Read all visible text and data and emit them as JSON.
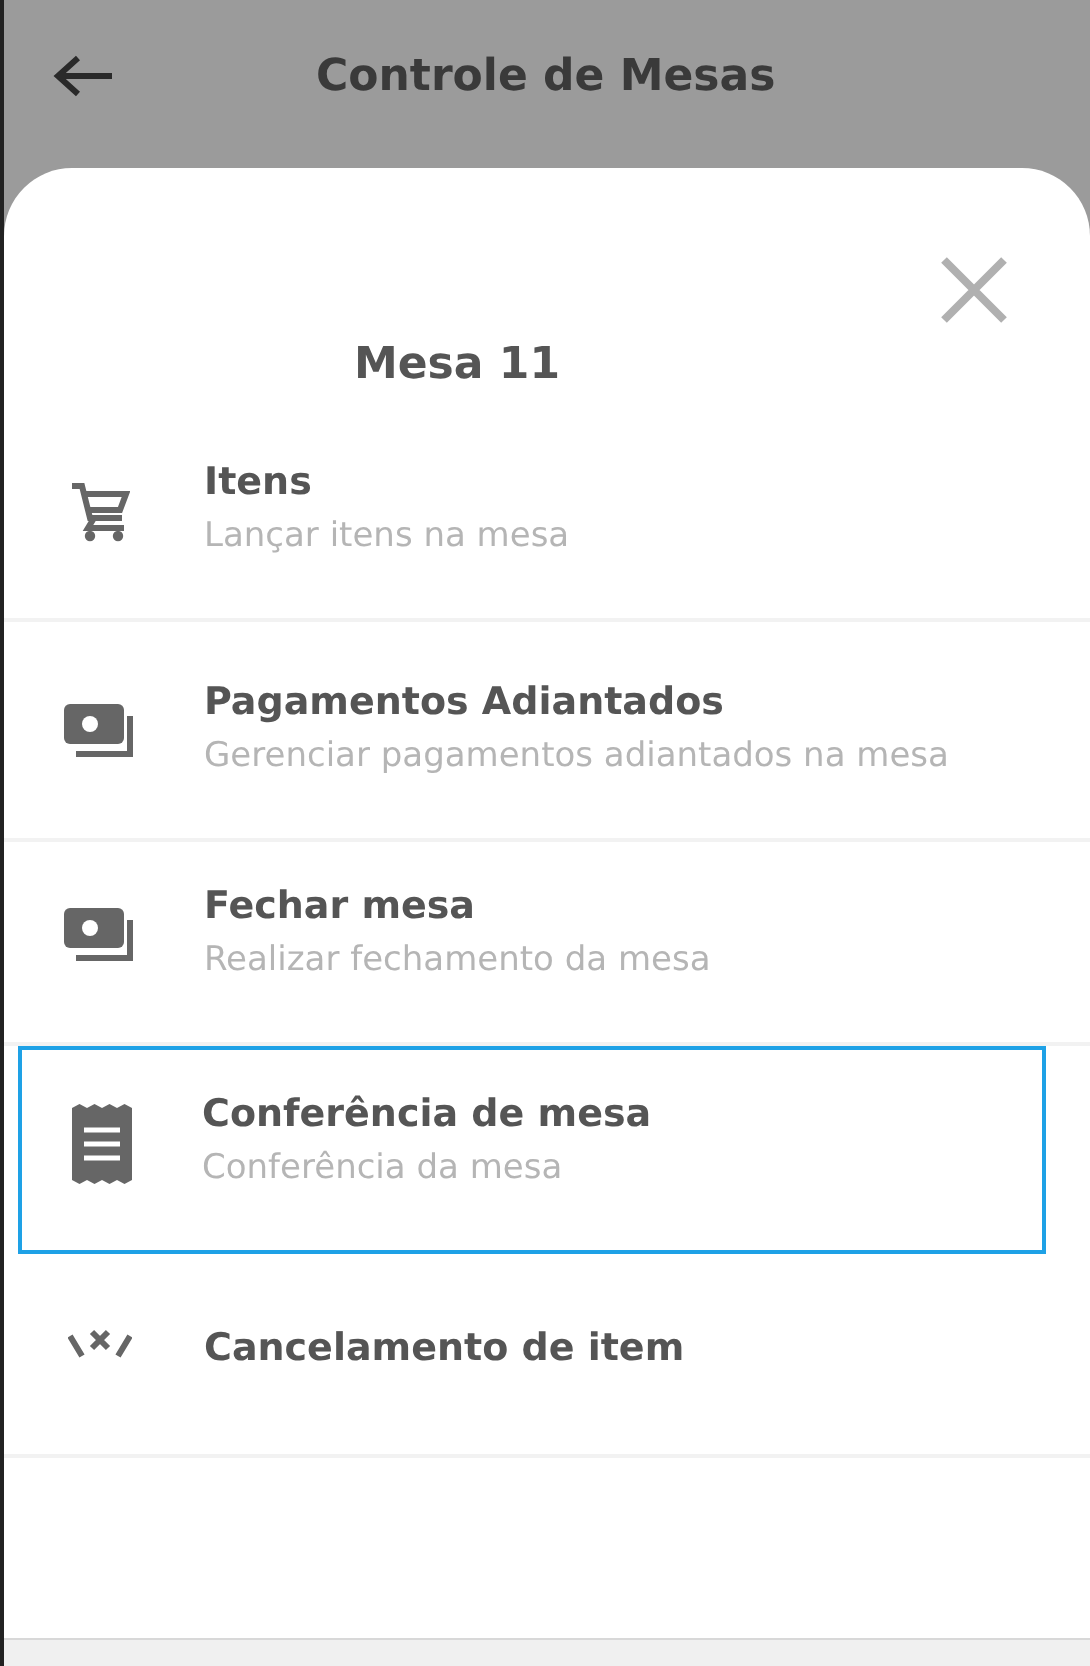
{
  "header": {
    "title": "Controle de Mesas"
  },
  "sheet": {
    "title": "Mesa 11",
    "items": [
      {
        "kind": "cart",
        "title": "Itens",
        "subtitle": "Lançar itens na mesa",
        "selected": false
      },
      {
        "kind": "money",
        "title": "Pagamentos Adiantados",
        "subtitle": "Gerenciar pagamentos adiantados na mesa",
        "selected": false
      },
      {
        "kind": "money",
        "title": "Fechar mesa",
        "subtitle": "Realizar fechamento da mesa",
        "selected": false
      },
      {
        "kind": "receipt",
        "title": "Conferência de mesa",
        "subtitle": "Conferência da mesa",
        "selected": true
      },
      {
        "kind": "cancel",
        "title": "Cancelamento de item",
        "selected": false
      }
    ]
  }
}
